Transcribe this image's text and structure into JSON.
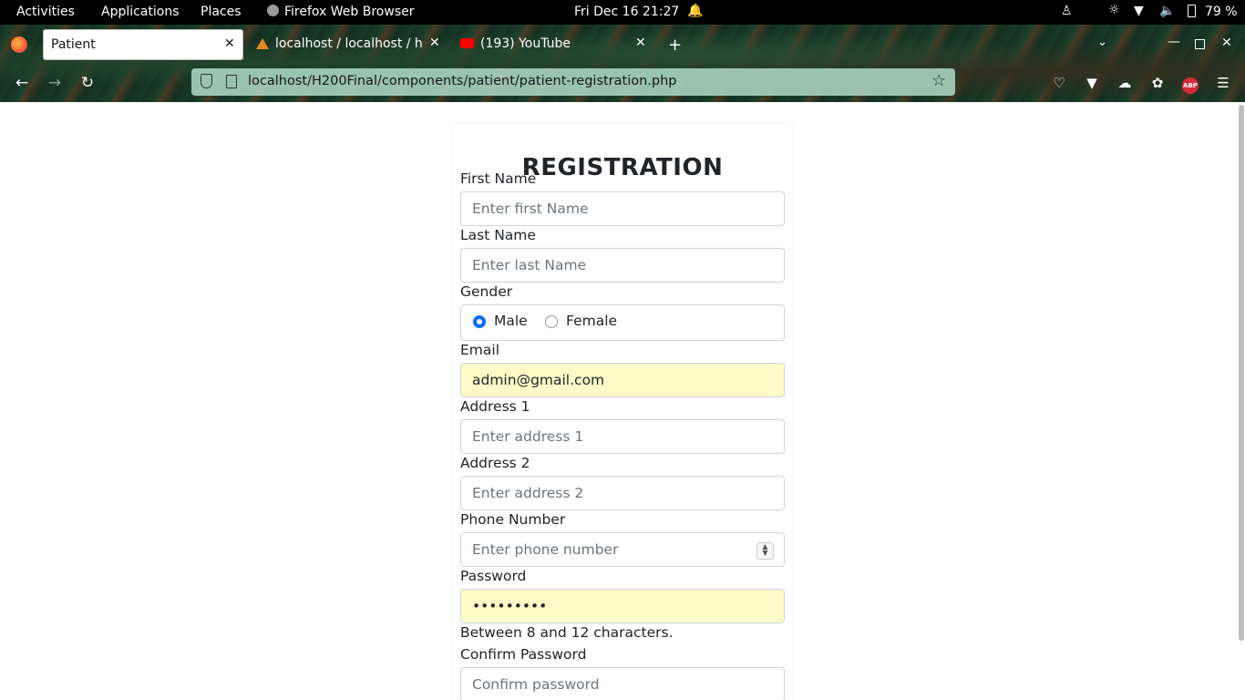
{
  "topbar": {
    "activities": "Activities",
    "applications": "Applications",
    "places": "Places",
    "app_name": "Firefox Web Browser",
    "clock": "Fri Dec 16  21:27",
    "battery": "79 %"
  },
  "browser": {
    "tabs": [
      {
        "label": "Patient"
      },
      {
        "label": "localhost / localhost / hit"
      },
      {
        "label": "(193) YouTube"
      }
    ],
    "url": "localhost/H200Final/components/patient/patient-registration.php"
  },
  "form": {
    "title": "REGISTRATION",
    "first_name_label": "First Name",
    "first_name_placeholder": "Enter first Name",
    "last_name_label": "Last Name",
    "last_name_placeholder": "Enter last Name",
    "gender_label": "Gender",
    "gender_options": [
      "Male",
      "Female"
    ],
    "gender_selected": "Male",
    "email_label": "Email",
    "email_value": "admin@gmail.com",
    "address1_label": "Address 1",
    "address1_placeholder": "Enter address 1",
    "address2_label": "Address 2",
    "address2_placeholder": "Enter address 2",
    "phone_label": "Phone Number",
    "phone_placeholder": "Enter phone number",
    "password_label": "Password",
    "password_value": "•••••••••",
    "password_help": "Between 8 and 12 characters.",
    "confirm_label": "Confirm Password",
    "confirm_placeholder": "Confirm password"
  },
  "colors": {
    "accent": "#0d6efd",
    "autofill": "#fffbc8"
  }
}
